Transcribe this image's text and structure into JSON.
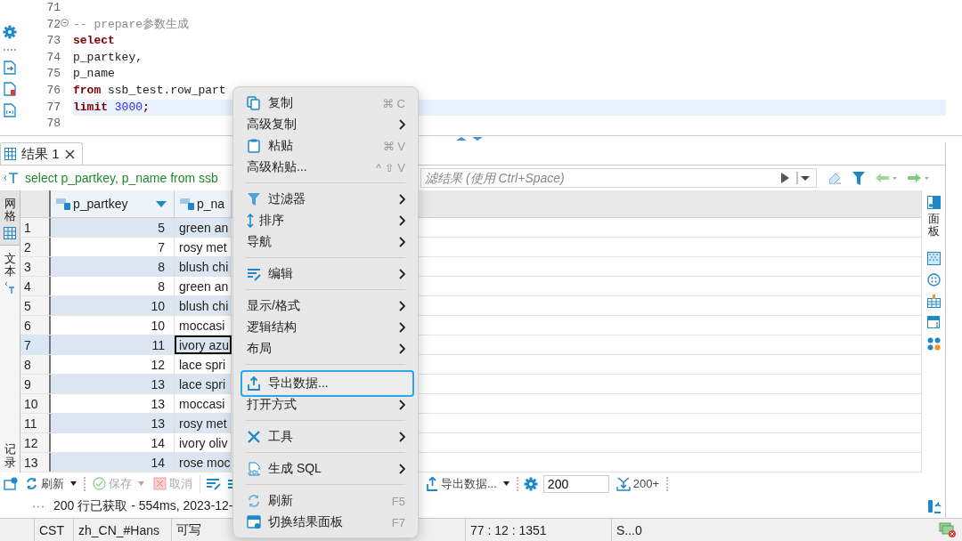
{
  "editor": {
    "lines": [
      {
        "number": "71",
        "current": false
      },
      {
        "number": "72",
        "current": false,
        "foldable": true,
        "tokens": [
          {
            "kind": "comment",
            "text": "-- prepare参数生成"
          }
        ]
      },
      {
        "number": "73",
        "current": false,
        "tokens": [
          {
            "kind": "keyword",
            "text": "select"
          }
        ]
      },
      {
        "number": "74",
        "current": false,
        "tokens": [
          {
            "kind": "plain",
            "text": "p_partkey,"
          }
        ]
      },
      {
        "number": "75",
        "current": false,
        "tokens": [
          {
            "kind": "plain",
            "text": "p_name"
          }
        ]
      },
      {
        "number": "76",
        "current": false,
        "tokens": [
          {
            "kind": "keyword",
            "text": "from"
          },
          {
            "kind": "plain",
            "text": " ssb_test.row_part"
          }
        ]
      },
      {
        "number": "77",
        "current": true,
        "tokens": [
          {
            "kind": "keyword",
            "text": "limit"
          },
          {
            "kind": "number",
            "text": " 3000"
          },
          {
            "kind": "punct",
            "text": ";"
          }
        ]
      },
      {
        "number": "78",
        "current": false
      }
    ]
  },
  "results_tab": {
    "label": "结果 1"
  },
  "query_bar": {
    "query": "select p_partkey, p_name from ssb",
    "filter_placeholder": "滤结果 (使用 Ctrl+Space)"
  },
  "side_tabs": [
    {
      "label": "网格",
      "selected": true
    },
    {
      "label": "文本",
      "selected": false
    }
  ],
  "record_tab": {
    "label": "记录"
  },
  "panel_tab": {
    "label": "面板"
  },
  "grid": {
    "columns": [
      {
        "label": "p_partkey",
        "sorted": true
      },
      {
        "label": "p_na",
        "sorted": false
      }
    ],
    "rows": [
      {
        "number": "1",
        "partkey": "5",
        "name": "green an",
        "selected": false
      },
      {
        "number": "2",
        "partkey": "7",
        "name": "rosy met",
        "selected": false
      },
      {
        "number": "3",
        "partkey": "8",
        "name": "blush chi",
        "selected": false
      },
      {
        "number": "4",
        "partkey": "8",
        "name": "green an",
        "selected": false
      },
      {
        "number": "5",
        "partkey": "10",
        "name": "blush chi",
        "selected": false
      },
      {
        "number": "6",
        "partkey": "10",
        "name": "moccasi",
        "selected": false
      },
      {
        "number": "7",
        "partkey": "11",
        "name": "ivory azu",
        "selected": true
      },
      {
        "number": "8",
        "partkey": "12",
        "name": "lace spri",
        "selected": false
      },
      {
        "number": "9",
        "partkey": "13",
        "name": "lace spri",
        "selected": false
      },
      {
        "number": "10",
        "partkey": "13",
        "name": "moccasi",
        "selected": false
      },
      {
        "number": "11",
        "partkey": "13",
        "name": "rosy met",
        "selected": false
      },
      {
        "number": "12",
        "partkey": "14",
        "name": "ivory oliv",
        "selected": false
      },
      {
        "number": "13",
        "partkey": "14",
        "name": "rose moc",
        "selected": false
      }
    ]
  },
  "toolbar": {
    "buttons": [
      {
        "label": "刷新",
        "disabled": false,
        "dropdown": true
      },
      {
        "label": "保存",
        "disabled": true,
        "dropdown": true
      },
      {
        "label": "取消",
        "disabled": true,
        "dropdown": false
      }
    ],
    "export": "导出数据...",
    "export_dropdown": true,
    "fetch_size": "200",
    "fetch_more": "200+"
  },
  "status_text": "200 行已获取 - 554ms, 2023-12-",
  "status_bar": [
    "CST",
    "zh_CN_#Hans",
    "可写",
    "77 : 12 : 1351",
    "S...0"
  ],
  "context_menu": [
    {
      "kind": "item",
      "label": "复制",
      "shortcut": "⌘ C",
      "submenu": false,
      "selected": false
    },
    {
      "kind": "item",
      "label": "高级复制",
      "submenu": true,
      "selected": false
    },
    {
      "kind": "item",
      "label": "粘贴",
      "shortcut": "⌘ V",
      "submenu": false,
      "selected": false
    },
    {
      "kind": "item",
      "label": "高级粘贴...",
      "shortcut": "^ ⇧ V",
      "submenu": false,
      "selected": false
    },
    {
      "kind": "separator"
    },
    {
      "kind": "item",
      "label": "过滤器",
      "submenu": true,
      "selected": false
    },
    {
      "kind": "item",
      "label": "排序",
      "submenu": true,
      "selected": false
    },
    {
      "kind": "item",
      "label": "导航",
      "submenu": true,
      "selected": false
    },
    {
      "kind": "separator"
    },
    {
      "kind": "item",
      "label": "编辑",
      "submenu": true,
      "selected": false
    },
    {
      "kind": "separator"
    },
    {
      "kind": "item",
      "label": "显示/格式",
      "submenu": true,
      "selected": false
    },
    {
      "kind": "item",
      "label": "逻辑结构",
      "submenu": true,
      "selected": false
    },
    {
      "kind": "item",
      "label": "布局",
      "submenu": true,
      "selected": false
    },
    {
      "kind": "separator"
    },
    {
      "kind": "item",
      "label": "导出数据...",
      "submenu": false,
      "selected": true
    },
    {
      "kind": "item",
      "label": "打开方式",
      "submenu": true,
      "selected": false
    },
    {
      "kind": "separator"
    },
    {
      "kind": "item",
      "label": "工具",
      "submenu": true,
      "selected": false
    },
    {
      "kind": "separator"
    },
    {
      "kind": "item",
      "label": "生成 SQL",
      "submenu": true,
      "selected": false
    },
    {
      "kind": "separator"
    },
    {
      "kind": "item",
      "label": "刷新",
      "shortcut": "F5",
      "submenu": false,
      "selected": false
    },
    {
      "kind": "item",
      "label": "切换结果面板",
      "shortcut": "F7",
      "submenu": false,
      "selected": false
    }
  ]
}
